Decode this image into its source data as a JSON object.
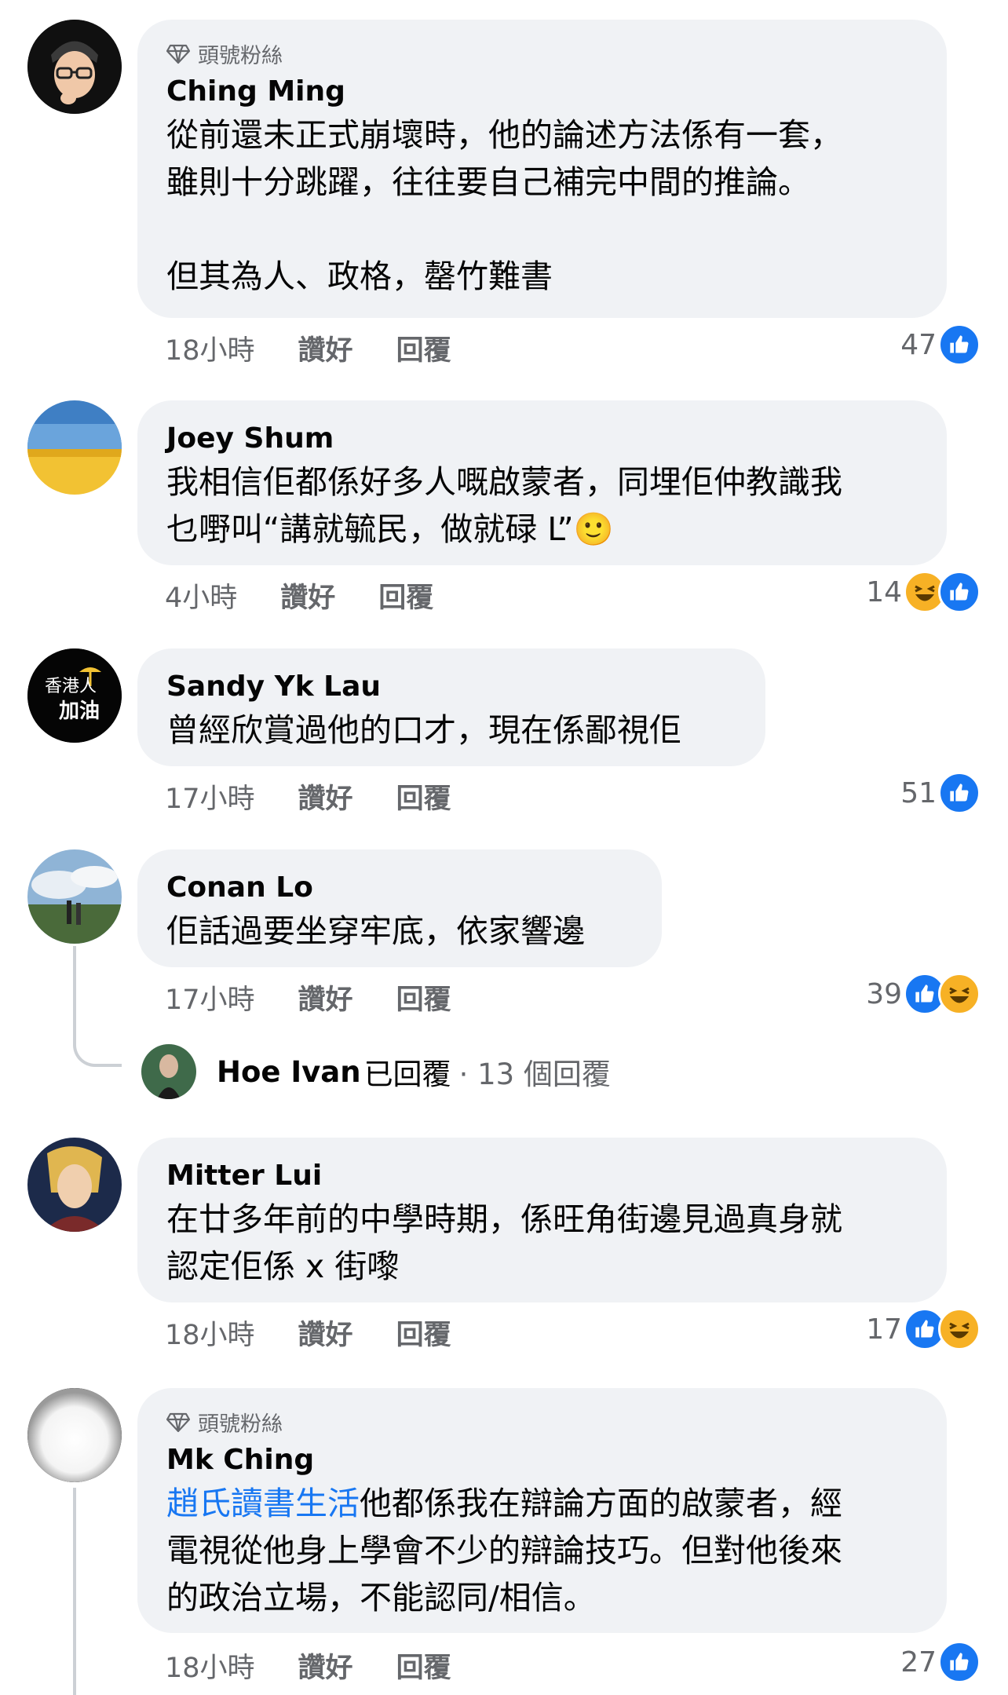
{
  "comments": [
    {
      "badge": "頭號粉絲",
      "name": "Ching Ming",
      "lines": [
        "從前還未正式崩壞時，他的論述方法係有一套，",
        "雖則十分跳躍，往往要自己補完中間的推論。",
        "",
        "但其為人、政格，罄竹難書"
      ],
      "time": "18小時",
      "like": "讚好",
      "reply": "回覆",
      "count": "47"
    },
    {
      "name": "Joey Shum",
      "lines": [
        "我相信佢都係好多人嘅啟蒙者，同埋佢仲教識我",
        "乜嘢叫“講就毓民，做就碌 L”🙂"
      ],
      "time": "4小時",
      "like": "讚好",
      "reply": "回覆",
      "count": "14"
    },
    {
      "name": "Sandy Yk Lau",
      "lines": [
        "曾經欣賞過他的口才，現在係鄙視佢"
      ],
      "time": "17小時",
      "like": "讚好",
      "reply": "回覆",
      "count": "51"
    },
    {
      "name": "Conan Lo",
      "lines": [
        "佢話過要坐穿牢底，依家響邊"
      ],
      "time": "17小時",
      "like": "讚好",
      "reply": "回覆",
      "count": "39",
      "reply_summary": {
        "name": "Hoe Ivan",
        "action": "已回覆",
        "count": "· 13 個回覆"
      }
    },
    {
      "name": "Mitter Lui",
      "lines": [
        "在廿多年前的中學時期，係旺角街邊見過真身就",
        "認定佢係 x 街嚟"
      ],
      "time": "18小時",
      "like": "讚好",
      "reply": "回覆",
      "count": "17"
    },
    {
      "badge": "頭號粉絲",
      "name": "Mk Ching",
      "link": "趙氏讀書生活",
      "line1_rest": "他都係我在辯論方面的啟蒙者，經",
      "lines_after": [
        "電視從他身上學會不少的辯論技巧。但對他後來",
        "的政治立場，不能認同/相信。"
      ],
      "time": "18小時",
      "like": "讚好",
      "reply": "回覆",
      "count": "27"
    }
  ],
  "avatar_text": {
    "sandy_l1": "香港人",
    "sandy_l2": "加油"
  },
  "colors": {
    "bubble": "#f0f2f5",
    "meta": "#65676b",
    "like": "#1877f2",
    "haha": "#f7b125"
  },
  "icons": [
    "diamond-icon",
    "like-reaction-icon",
    "haha-reaction-icon"
  ]
}
